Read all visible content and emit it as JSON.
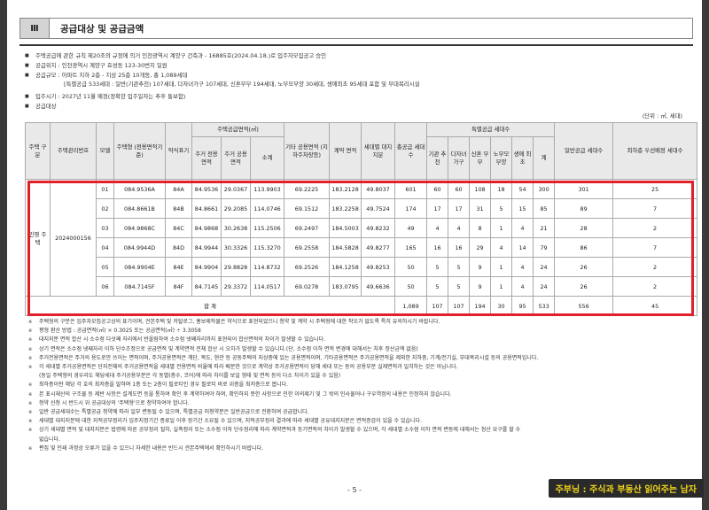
{
  "section": {
    "number": "Ⅲ",
    "title": "공급대상 및 공급금액"
  },
  "info_lines": [
    "주택공급에 관한 규칙 제20조의 규정에 의거 인천광역시 계양구 건축과 - 16885호(2024.04.18.)로 입주자모집공고 승인",
    "공급위치 : 인천광역시 계양구 효성동 123-30번지 일원",
    "공급규모 : 아파트 지하 2층 - 지상 25층 10개동, 총 1,089세대",
    "[특별공급 533세대 : 일반(기관추천) 107세대, 다자녀가구 107세대, 신혼부부 194세대, 노부모부양 30세대, 생애최초 95세대 포함 및 부대복리시설",
    "입주시기 : 2027년 11월 예정(정확한 입주일자는 추후 통보함)",
    "공급대상"
  ],
  "unit_label": "(단위 : ㎡, 세대)",
  "table": {
    "headers": {
      "housing_type": "주택 구분",
      "mgmt_no": "주택관리번호",
      "model": "모델",
      "type": "주택형 (전용면적기준)",
      "short": "약식표기",
      "supply_area": "주택공급면적(㎡)",
      "excl": "주거 전용면적",
      "common": "주거 공용면적",
      "subtotal": "소계",
      "other": "기타 공용면적 (지하주차장등)",
      "contract": "계약 면적",
      "land": "세대별 대지지분",
      "total_units": "총공급 세대수",
      "special": "특별공급 세대수",
      "inst": "기관 추천",
      "multi": "다자녀 가구",
      "newlywed": "신혼 부부",
      "elder": "노부모 부양",
      "first": "생애 최초",
      "sum": "계",
      "general": "일반공급 세대수",
      "lowest": "최하층 우선배정 세대수"
    },
    "housing_type_value": "민영 주택",
    "mgmt_no_value": "2024000156",
    "rows": [
      {
        "model": "01",
        "type": "084.9536A",
        "short": "84A",
        "excl": "84.9536",
        "common": "29.0367",
        "subtotal": "113.9903",
        "other": "69.2225",
        "contract": "183.2128",
        "land": "49.8037",
        "total": "601",
        "inst": "60",
        "multi": "60",
        "newlywed": "108",
        "elder": "18",
        "first": "54",
        "sum": "300",
        "general": "301",
        "lowest": "25"
      },
      {
        "model": "02",
        "type": "084.8661B",
        "short": "84B",
        "excl": "84.8661",
        "common": "29.2085",
        "subtotal": "114.0746",
        "other": "69.1512",
        "contract": "183.2258",
        "land": "49.7524",
        "total": "174",
        "inst": "17",
        "multi": "17",
        "newlywed": "31",
        "elder": "5",
        "first": "15",
        "sum": "85",
        "general": "89",
        "lowest": "7"
      },
      {
        "model": "03",
        "type": "084.9868C",
        "short": "84C",
        "excl": "84.9868",
        "common": "30.2638",
        "subtotal": "115.2506",
        "other": "69.2497",
        "contract": "184.5003",
        "land": "49.8232",
        "total": "49",
        "inst": "4",
        "multi": "4",
        "newlywed": "8",
        "elder": "1",
        "first": "4",
        "sum": "21",
        "general": "28",
        "lowest": "2"
      },
      {
        "model": "04",
        "type": "084.9944D",
        "short": "84D",
        "excl": "84.9944",
        "common": "30.3326",
        "subtotal": "115.3270",
        "other": "69.2558",
        "contract": "184.5828",
        "land": "49.8277",
        "total": "165",
        "inst": "16",
        "multi": "16",
        "newlywed": "29",
        "elder": "4",
        "first": "14",
        "sum": "79",
        "general": "86",
        "lowest": "7"
      },
      {
        "model": "05",
        "type": "084.9904E",
        "short": "84E",
        "excl": "84.9904",
        "common": "29.8828",
        "subtotal": "114.8732",
        "other": "69.2526",
        "contract": "184.1258",
        "land": "49.8253",
        "total": "50",
        "inst": "5",
        "multi": "5",
        "newlywed": "9",
        "elder": "1",
        "first": "4",
        "sum": "24",
        "general": "26",
        "lowest": "2"
      },
      {
        "model": "06",
        "type": "084.7145F",
        "short": "84F",
        "excl": "84.7145",
        "common": "29.3372",
        "subtotal": "114.0517",
        "other": "69.0278",
        "contract": "183.0795",
        "land": "49.6636",
        "total": "50",
        "inst": "5",
        "multi": "5",
        "newlywed": "9",
        "elder": "1",
        "first": "4",
        "sum": "24",
        "general": "26",
        "lowest": "2"
      }
    ],
    "total_row": {
      "label": "합 계",
      "total": "1,089",
      "inst": "107",
      "multi": "107",
      "newlywed": "194",
      "elder": "30",
      "first": "95",
      "sum": "533",
      "general": "556",
      "lowest": "45"
    }
  },
  "notes": [
    {
      "text": "주택형의 구분은 입주자모집공고상의 표기이며, 견본주택 및 카탈로그, 홍보제작물은 약식으로 표현되었으니 청약 및 계약 시 주택형에 대한 착오가 없도록 특히 유의하시기 바랍니다.",
      "cont": ""
    },
    {
      "text": "평형 환산 방법 : 공급면적(㎡) × 0.3025 또는 공급면적(㎡) ÷ 3.3058",
      "cont": ""
    },
    {
      "text": "대지지분 면적 합산 시 소수점 다섯째 자리에서 반올림하여 소수점 넷째자리까지 표현되어 합산면적의 차이가 발생할 수 있습니다.",
      "cont": ""
    },
    {
      "text": "상기 면적은 소수점 넷째자리 이하 단수조정으로 공급면적 및 계약면적 전체 합산 시 오차가 발생할 수 있습니다.(단, 소수점 이하 면적 변경에 대해서는 차후 정산금액 없음)",
      "cont": ""
    },
    {
      "text": "주거전용면적은 주거의 용도로만 쓰이는 면적이며, 주거공용면적은 계단, 복도, 현관 등 공동주택의 지상층에 있는 공용면적이며, 기타공용면적은 주거공용면적을 제외한 지하층, 기계/전기실, 부대복리시설 등의 공용면적입니다.",
      "cont": ""
    },
    {
      "text": "각 세대별 주거공용면적은 단지전체의 주거공용면적을 세대별 전용면적 비율에 따라 배분한 것으로 계약상 주거공용면적이 당해 세대 또는 동의 공용부분 실제면적과 일치하는 것은 아닙니다.",
      "cont": "(동일 주택형의 경우라도 해당세대 주거공용부분은 각 동별(층수, 코어)에 따라 차이를 보일 형태 및 면적 등이 다소 차이가 있을 수 있음)"
    },
    {
      "text": "최하층이란 해당 각 호의 최저층을 말하며 1층 또는 2층이 필로티인 경우 필로티 바로 위층을 최저층으로 봅니다.",
      "cont": ""
    },
    {
      "text": "본 표시재산의 구조물 등 제반 사항은 설계도면 등을 통하여 확인 후 계약하여야 하며, 확인하지 못한 사항으로 인한 이의제기 및 그 밖의 민사물어나 구우역정의 내용은 인정하지 않습니다.",
      "cont": ""
    },
    {
      "text": "청약 신청 시 반드시 위 공급대상의 '주택형'으로 청약하여야 합니다.",
      "cont": ""
    },
    {
      "text": "일반 공급세대수는 특별공급 청약에 따라 일부 변동될 수 있으며, 특별공급 미청약분은 일반공급으로 전환하여 공급합니다.",
      "cont": ""
    },
    {
      "text": "세대별 대지지분에 대한 지적공부정리가 입주지정기간 종료일 이후 장기간 소요될 수 있으며, 지적공부정리 결과에 따라 세대별 공유대지지분은 면적증감이 있을 수 있습니다.",
      "cont": ""
    },
    {
      "text": "상기 세대별 면적 및 대지지분은 법령에 따른 공부정리 절차, 실측정리 또는 소수점 이하 단수정리에 따라 계약면적과 등기면적의 차이가 발생할 수 있으며, 각 세대별 소수점 이하 면적 변동에 대해서는 정산 요구를 할 수",
      "cont": "없습니다."
    },
    {
      "text": "편집 및 인쇄 과정상 오류가 있을 수 있으니 자세한 내용은 반드시 견본주택에서 확인하시기 바랍니다.",
      "cont": ""
    }
  ],
  "page_number": "- 5 -",
  "watermark": "주부닝 : 주식과 부동산 읽어주는 남자"
}
